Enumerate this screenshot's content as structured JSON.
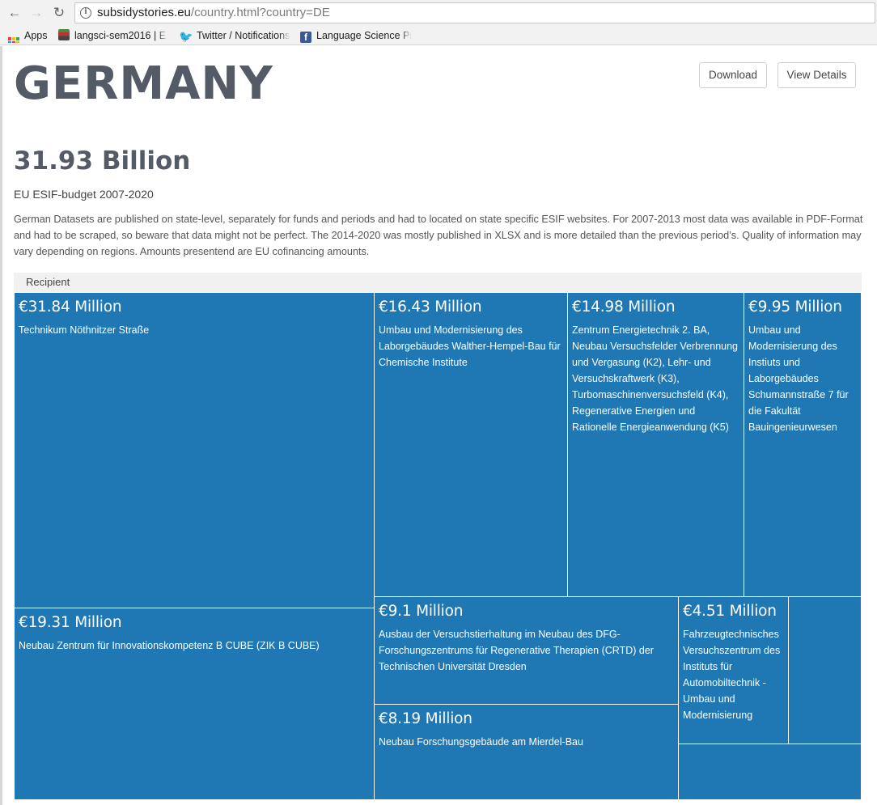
{
  "browser": {
    "url_domain": "subsidystories.eu",
    "url_path": "/country.html?country=DE",
    "bookmarks": [
      "Apps",
      "langsci-sem2016 | E",
      "Twitter / Notifications",
      "Language Science Pr"
    ]
  },
  "page": {
    "title": "GERMANY",
    "download_label": "Download",
    "details_label": "View Details",
    "total": "31.93 Billion",
    "budget_label": "EU ESIF-budget 2007-2020",
    "description": "German Datasets are published on state-level, separately for funds and periods and had to located on state specific ESIF websites. For 2007-2013 most data was available in PDF-Format and had to be scraped, so beware that data might not be perfect. The 2014-2020 was mostly published in XLSX and is more detailed than the previous period’s. Quality of information may vary depending on regions. Amounts presentend are EU cofinancing amounts.",
    "treemap_header": "Recipient"
  },
  "treemap": [
    {
      "amount": "€31.84 Million",
      "label": "Technikum Nöthnitzer Straße"
    },
    {
      "amount": "€19.31 Million",
      "label": "Neubau Zentrum für Innovationskompetenz B CUBE (ZIK B CUBE)"
    },
    {
      "amount": "€16.43 Million",
      "label": "Umbau und Modernisierung des Laborgebäudes Walther-Hempel-Bau für Chemische Institute"
    },
    {
      "amount": "€14.98 Million",
      "label": "Zentrum Energietechnik 2. BA, Neubau Versuchsfelder Verbrennung und Vergasung (K2), Lehr- und Versuchskraftwerk (K3), Turbomaschinenversuchsfeld (K4), Regenerative Energien und Rationelle Energieanwendung (K5)"
    },
    {
      "amount": "€9.95 Million",
      "label": "Umbau und Modernisierung des Instiuts und Laborgebäudes Schumannstraße 7 für die Fakultät Bauingenieurwesen"
    },
    {
      "amount": "€9.1 Million",
      "label": "Ausbau der Versuchstierhaltung im Neubau des DFG-Forschungszentrums für Regenerative Therapien (CRTD) der Technischen Universität Dresden"
    },
    {
      "amount": "€8.19 Million",
      "label": "Neubau Forschungsgebäude am Mierdel-Bau"
    },
    {
      "amount": "€4.51 Million",
      "label": "Fahrzeugtechnisches Versuchszentrum des Instituts für Automobiltechnik - Umbau und Modernisierung"
    },
    {
      "amount": "",
      "label": ""
    },
    {
      "amount": "",
      "label": ""
    }
  ],
  "colors": {
    "treemap_fill": "#1f77b4",
    "title": "#545b66"
  }
}
